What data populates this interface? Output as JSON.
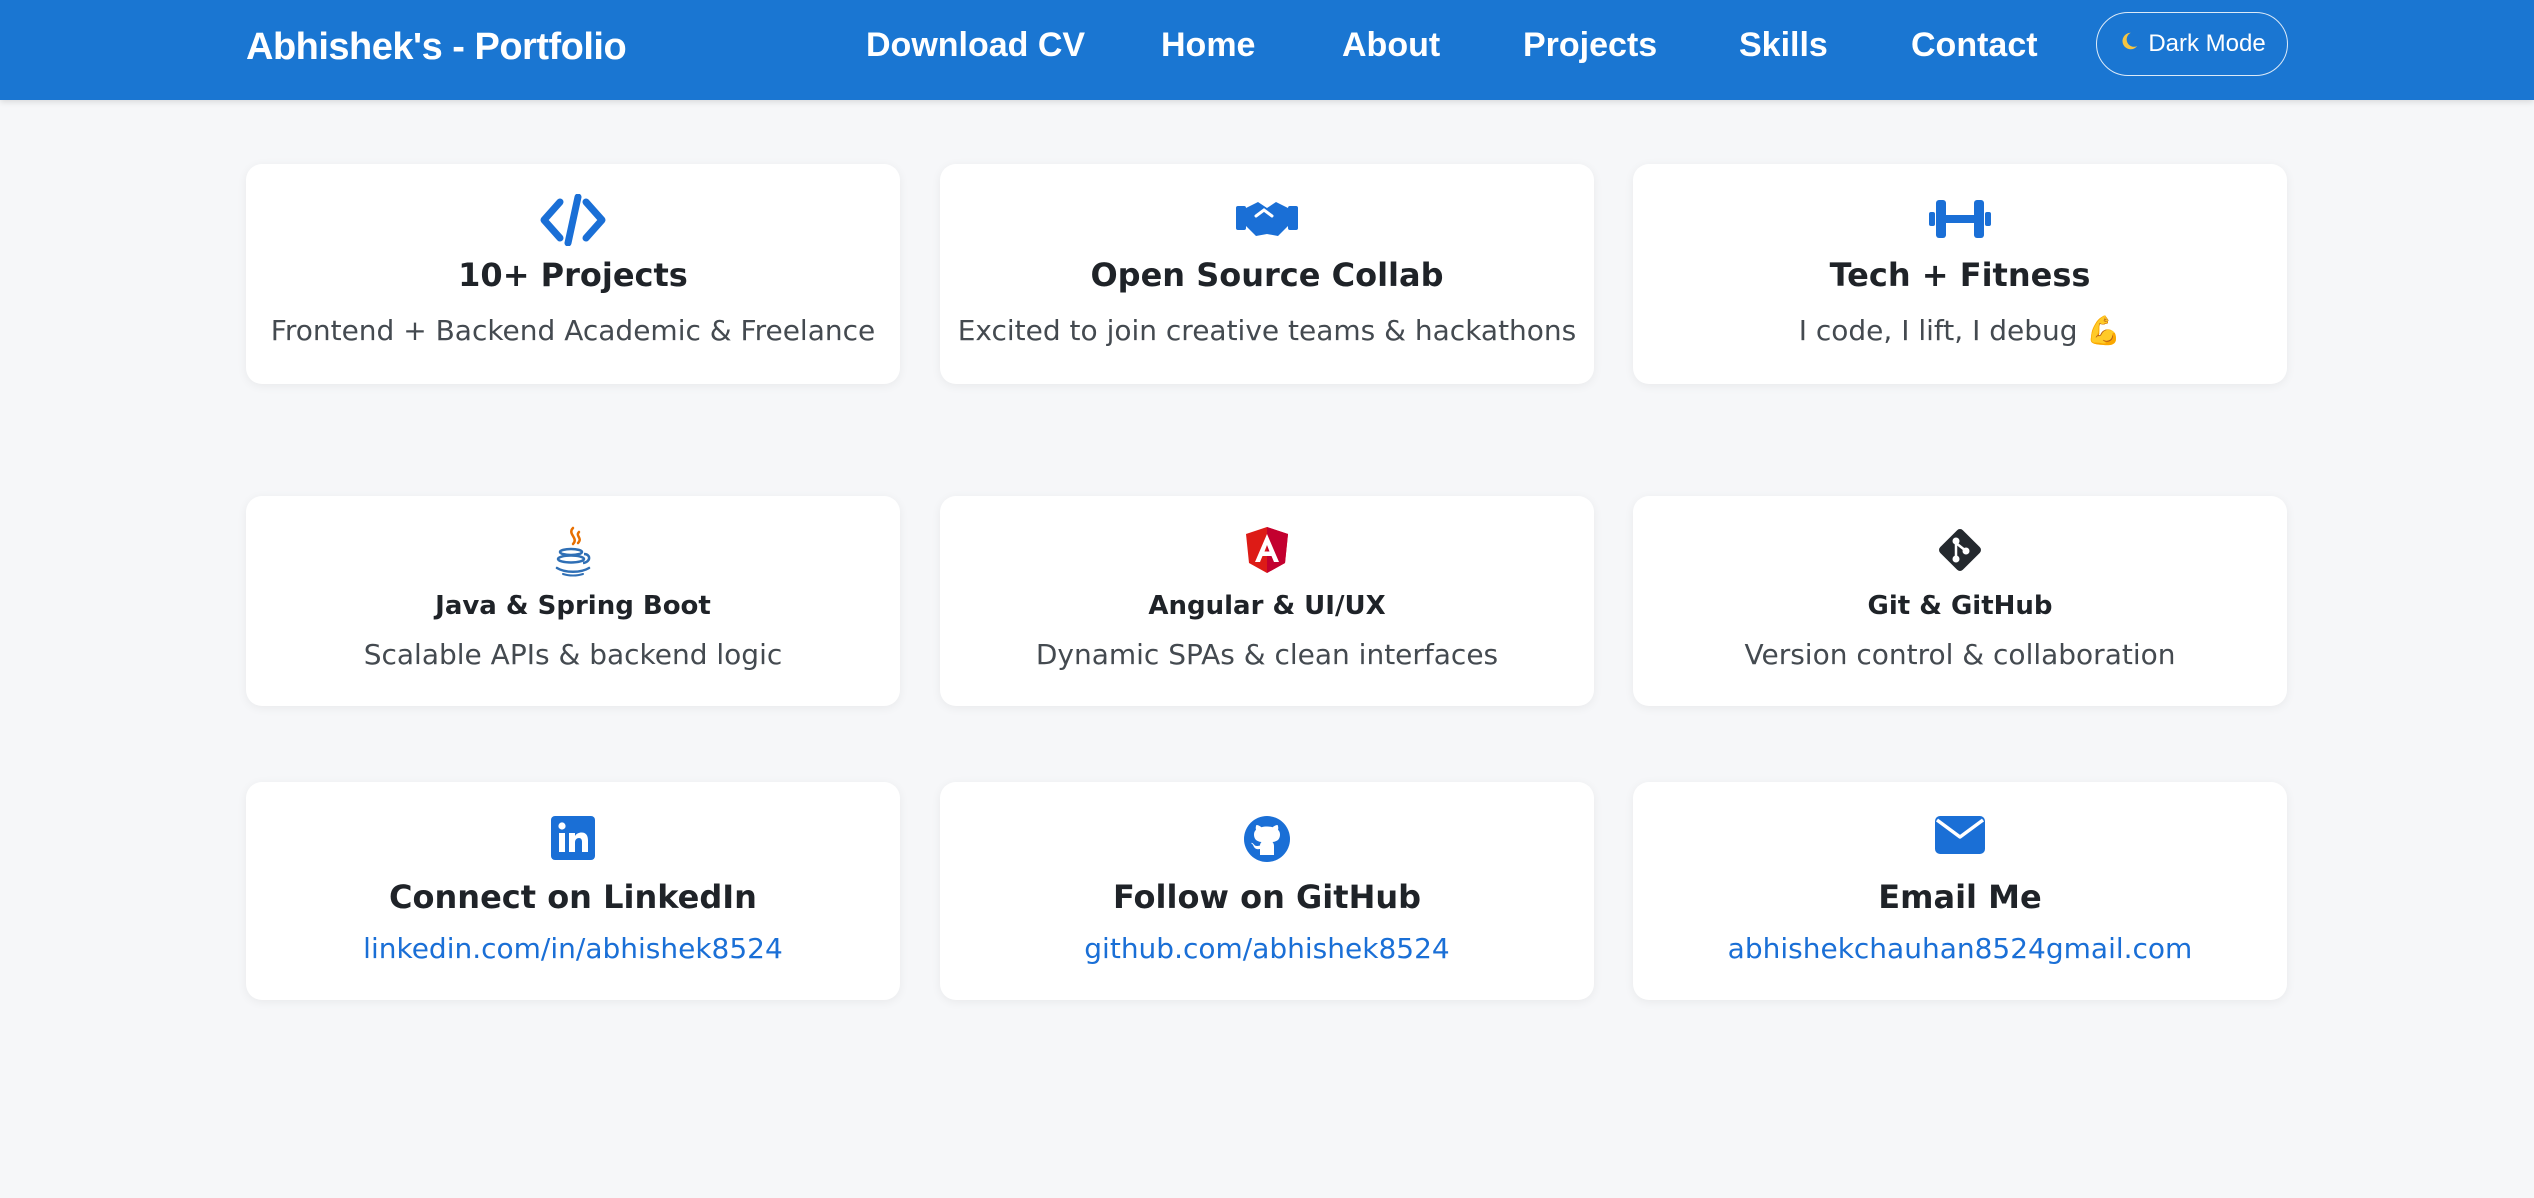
{
  "navbar": {
    "brand": "Abhishek's - Portfolio",
    "links": [
      "Download CV",
      "Home",
      "About",
      "Projects",
      "Skills",
      "Contact"
    ],
    "dark_mode_label": "Dark Mode",
    "dark_mode_icon": "crescent-moon-icon",
    "background": "#1a76d2"
  },
  "highlights": [
    {
      "icon": "code-icon",
      "title": "10+ Projects",
      "desc": "Frontend + Backend Academic & Freelance"
    },
    {
      "icon": "handshake-icon",
      "title": "Open Source Collab",
      "desc": "Excited to join creative teams & hackathons"
    },
    {
      "icon": "dumbbell-icon",
      "title": "Tech + Fitness",
      "desc": "I code, I lift, I debug 💪"
    }
  ],
  "skills": [
    {
      "icon": "java-icon",
      "title": "Java & Spring Boot",
      "desc": "Scalable APIs & backend logic"
    },
    {
      "icon": "angular-icon",
      "title": "Angular & UI/UX",
      "desc": "Dynamic SPAs & clean interfaces"
    },
    {
      "icon": "git-icon",
      "title": "Git & GitHub",
      "desc": "Version control & collaboration"
    }
  ],
  "contacts": [
    {
      "icon": "linkedin-icon",
      "title": "Connect on LinkedIn",
      "link": "linkedin.com/in/abhishek8524"
    },
    {
      "icon": "github-icon",
      "title": "Follow on GitHub",
      "link": "github.com/abhishek8524"
    },
    {
      "icon": "email-icon",
      "title": "Email Me",
      "link": "abhishekchauhan8524gmail.com"
    }
  ],
  "colors": {
    "accent": "#1a6fd6",
    "page_bg": "#f6f7f9",
    "angular_red": "#dd1b16"
  }
}
